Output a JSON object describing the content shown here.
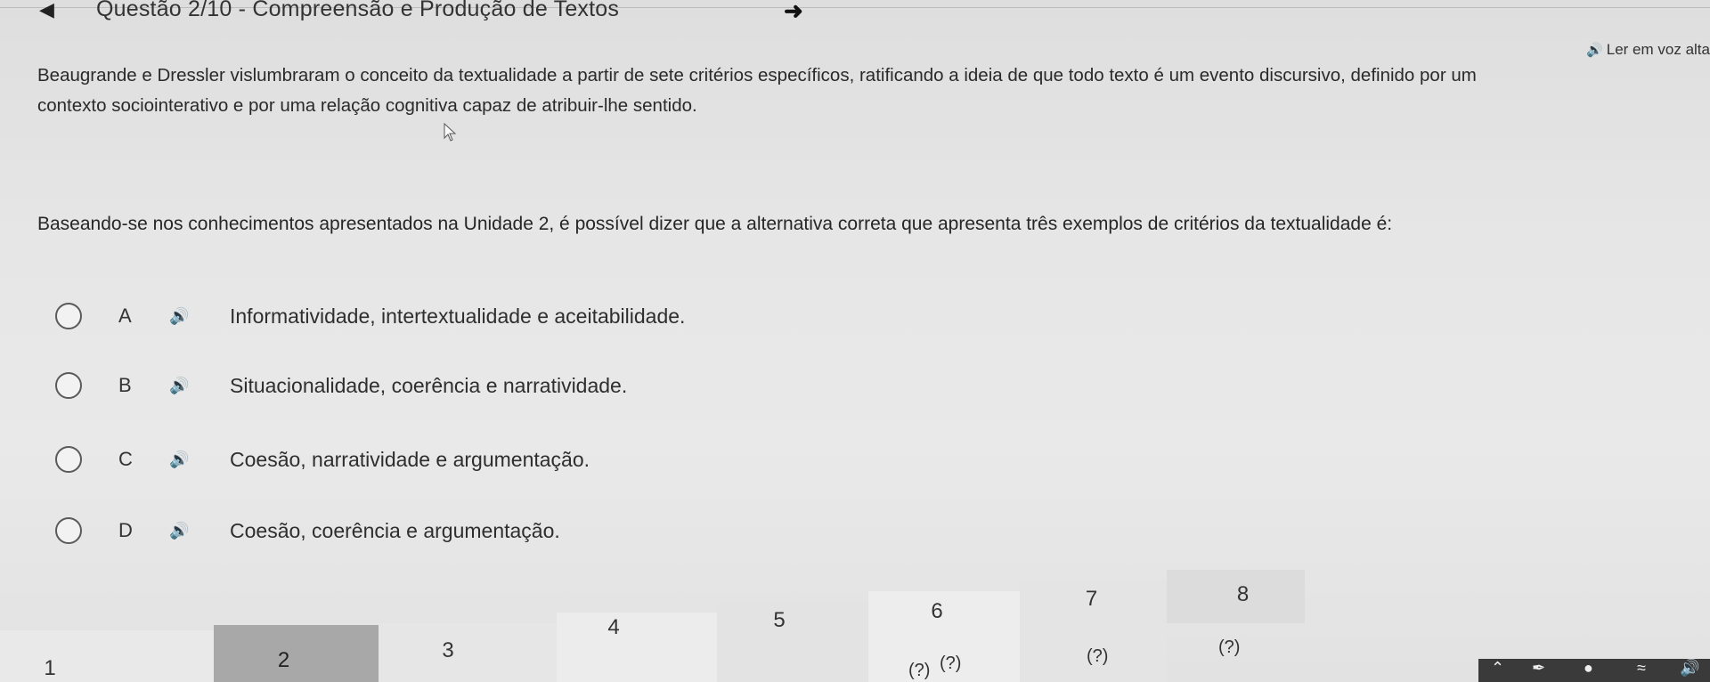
{
  "header": {
    "question_title": "Questão 2/10 - Compreensão e Produção de Textos",
    "read_aloud_label": "Ler em voz alta"
  },
  "statement": {
    "line1": "Beaugrande e Dressler vislumbraram o conceito da textualidade a partir de sete critérios específicos, ratificando a ideia de que todo texto é um evento discursivo, definido por um",
    "line2": "contexto sociointerativo e por uma relação cognitiva capaz de atribuir-lhe sentido."
  },
  "prompt": "Baseando-se nos conhecimentos apresentados na Unidade 2, é possível dizer que a alternativa correta que apresenta três exemplos de critérios da textualidade é:",
  "options": [
    {
      "letter": "A",
      "text": "Informatividade, intertextualidade e aceitabilidade."
    },
    {
      "letter": "B",
      "text": "Situacionalidade, coerência e narratividade."
    },
    {
      "letter": "C",
      "text": "Coesão, narratividade e argumentação."
    },
    {
      "letter": "D",
      "text": "Coesão, coerência e argumentação."
    }
  ],
  "question_nav": {
    "numbers": [
      "1",
      "2",
      "3",
      "4",
      "5",
      "6",
      "7",
      "8"
    ],
    "status_hints": [
      "(?)",
      "(?)",
      "(?)",
      "(?)"
    ]
  },
  "icons": {
    "back": "arrow-left-icon",
    "next": "arrow-right-icon",
    "speaker": "speaker-icon",
    "cursor": "mouse-pointer-icon"
  }
}
